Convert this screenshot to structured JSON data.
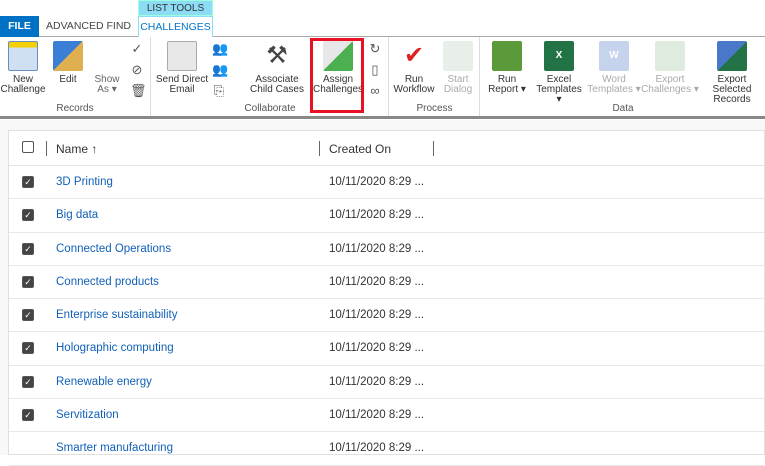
{
  "tabs": {
    "file": "FILE",
    "advanced_find": "ADVANCED FIND",
    "context_header": "LIST TOOLS",
    "challenges": "CHALLENGES"
  },
  "ribbon": {
    "records": {
      "label": "Records",
      "new": "New Challenge",
      "edit": "Edit",
      "show_as": "Show As"
    },
    "collaborate": {
      "label": "Collaborate",
      "send_email": "Send Direct Email",
      "associate": "Associate Child Cases",
      "assign": "Assign Challenges"
    },
    "process": {
      "label": "Process",
      "run_workflow": "Run Workflow",
      "start_dialog": "Start Dialog"
    },
    "data": {
      "label": "Data",
      "run_report": "Run Report",
      "excel": "Excel Templates",
      "word": "Word Templates",
      "export": "Export Challenges",
      "export_selected": "Export Selected Records"
    }
  },
  "grid": {
    "columns": [
      "Name ↑",
      "Created On"
    ],
    "rows": [
      {
        "name": "3D Printing",
        "created": "10/11/2020 8:29 ...",
        "checked": true
      },
      {
        "name": "Big data",
        "created": "10/11/2020 8:29 ...",
        "checked": true
      },
      {
        "name": "Connected Operations",
        "created": "10/11/2020 8:29 ...",
        "checked": true
      },
      {
        "name": "Connected products",
        "created": "10/11/2020 8:29 ...",
        "checked": true
      },
      {
        "name": "Enterprise sustainability",
        "created": "10/11/2020 8:29 ...",
        "checked": true
      },
      {
        "name": "Holographic computing",
        "created": "10/11/2020 8:29 ...",
        "checked": true
      },
      {
        "name": "Renewable energy",
        "created": "10/11/2020 8:29 ...",
        "checked": true
      },
      {
        "name": "Servitization",
        "created": "10/11/2020 8:29 ...",
        "checked": true
      },
      {
        "name": "Smarter manufacturing",
        "created": "10/11/2020 8:29 ...",
        "checked": false
      }
    ]
  }
}
